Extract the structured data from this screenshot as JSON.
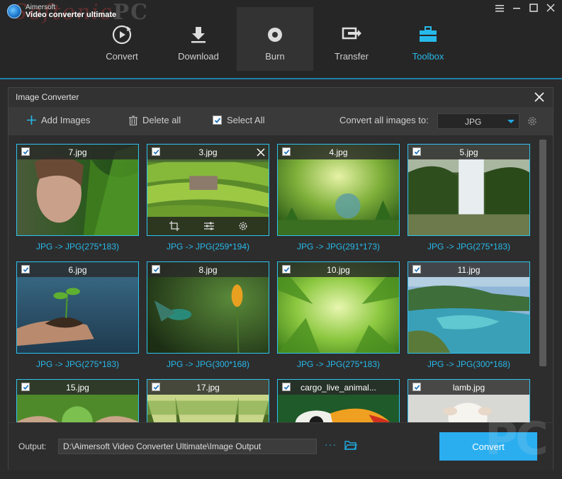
{
  "app": {
    "company": "Aimersoft",
    "product": "Video converter ultimate"
  },
  "nav": [
    {
      "label": "Convert",
      "icon": "convert-icon"
    },
    {
      "label": "Download",
      "icon": "download-icon"
    },
    {
      "label": "Burn",
      "icon": "burn-disc-icon"
    },
    {
      "label": "Transfer",
      "icon": "transfer-icon"
    },
    {
      "label": "Toolbox",
      "icon": "toolbox-icon",
      "selected": true
    }
  ],
  "dialog": {
    "title": "Image Converter",
    "toolbar": {
      "add_images": "Add Images",
      "delete_all": "Delete all",
      "select_all": "Select All",
      "convert_all_label": "Convert all images to:",
      "format": "JPG"
    },
    "images": [
      {
        "name": "7.jpg",
        "caption": "JPG -> JPG(275*183)"
      },
      {
        "name": "3.jpg",
        "caption": "JPG -> JPG(259*194)"
      },
      {
        "name": "4.jpg",
        "caption": "JPG -> JPG(291*173)"
      },
      {
        "name": "5.jpg",
        "caption": "JPG -> JPG(275*183)"
      },
      {
        "name": "6.jpg",
        "caption": "JPG -> JPG(275*183)"
      },
      {
        "name": "8.jpg",
        "caption": "JPG -> JPG(300*168)"
      },
      {
        "name": "10.jpg",
        "caption": "JPG -> JPG(275*183)"
      },
      {
        "name": "11.jpg",
        "caption": "JPG -> JPG(300*168)"
      },
      {
        "name": "15.jpg",
        "caption": ""
      },
      {
        "name": "17.jpg",
        "caption": ""
      },
      {
        "name": "cargo_live_animal...",
        "caption": ""
      },
      {
        "name": "lamb.jpg",
        "caption": ""
      }
    ],
    "footer": {
      "output_label": "Output:",
      "output_path": "D:\\Aimersoft Video Converter Ultimate\\Image Output",
      "more": "···",
      "convert": "Convert"
    }
  },
  "colors": {
    "accent": "#2aaef0",
    "selected_text": "#27b9ea",
    "card_border": "#2fc3f0"
  }
}
